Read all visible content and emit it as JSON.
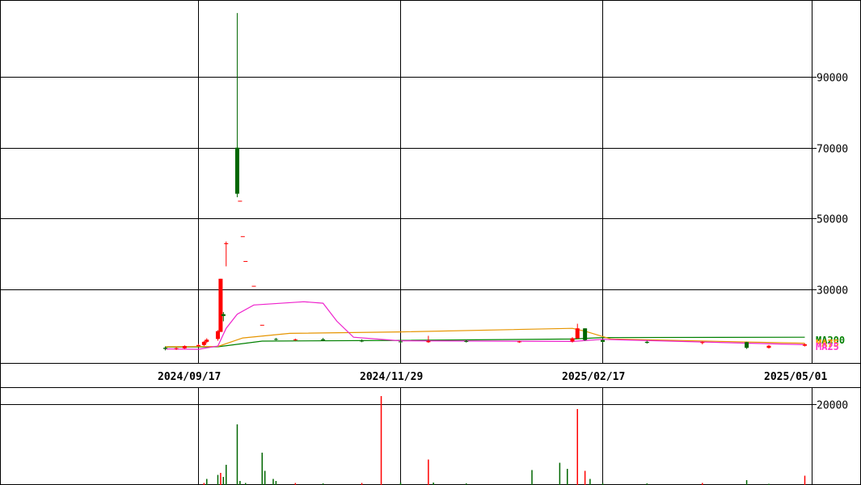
{
  "chart_data": [
    {
      "type": "candlestick",
      "title": "",
      "y_ticks": [
        "30000",
        "50000",
        "70000",
        "90000"
      ],
      "ylim": [
        10000,
        110000
      ],
      "x_ticks": [
        "2024/09/17",
        "2024/11/29",
        "2025/02/17",
        "2025/05/01"
      ],
      "grid": true,
      "legend": [
        {
          "name": "MA200",
          "color": "#008000"
        },
        {
          "name": "MA75",
          "color": "#ff9900"
        },
        {
          "name": "MA25",
          "color": "#ff33cc"
        }
      ],
      "colors": {
        "up": "#ff0000",
        "down": "#006600",
        "ma200": "#008000",
        "ma75": "#e69500",
        "ma25": "#ee22cc"
      },
      "candles": [
        {
          "date": "2024/09/05",
          "open": 13500,
          "high": 13900,
          "low": 12800,
          "close": 13200
        },
        {
          "date": "2024/09/09",
          "open": 13200,
          "high": 13700,
          "low": 12900,
          "close": 13400
        },
        {
          "date": "2024/09/12",
          "open": 13400,
          "high": 14200,
          "low": 13200,
          "close": 14000
        },
        {
          "date": "2024/09/17",
          "open": 14000,
          "high": 14600,
          "low": 13800,
          "close": 14300
        },
        {
          "date": "2024/09/19",
          "open": 14300,
          "high": 15500,
          "low": 14000,
          "close": 15200
        },
        {
          "date": "2024/09/20",
          "open": 15200,
          "high": 16200,
          "low": 14800,
          "close": 15800
        },
        {
          "date": "2024/09/24",
          "open": 16000,
          "high": 18500,
          "low": 15500,
          "close": 18200
        },
        {
          "date": "2024/09/25",
          "open": 18000,
          "high": 33000,
          "low": 18000,
          "close": 33000
        },
        {
          "date": "2024/09/26",
          "open": 23000,
          "high": 23600,
          "low": 21000,
          "close": 22500
        },
        {
          "date": "2024/09/27",
          "open": 43000,
          "high": 43500,
          "low": 36500,
          "close": 43000
        },
        {
          "date": "2024/10/01",
          "open": 70000,
          "high": 108000,
          "low": 56000,
          "close": 57000
        },
        {
          "date": "2024/10/02",
          "open": 55000,
          "high": 55000,
          "low": 55000,
          "close": 55000
        },
        {
          "date": "2024/10/03",
          "open": 45000,
          "high": 45000,
          "low": 45000,
          "close": 45000
        },
        {
          "date": "2024/10/04",
          "open": 38000,
          "high": 38000,
          "low": 38000,
          "close": 38000
        },
        {
          "date": "2024/10/07",
          "open": 31000,
          "high": 31000,
          "low": 31000,
          "close": 31000
        },
        {
          "date": "2024/10/10",
          "open": 20000,
          "high": 20000,
          "low": 20000,
          "close": 20000
        },
        {
          "date": "2024/10/15",
          "open": 16000,
          "high": 16300,
          "low": 15600,
          "close": 15800
        },
        {
          "date": "2024/10/22",
          "open": 15800,
          "high": 16100,
          "low": 15500,
          "close": 15900
        },
        {
          "date": "2024/11/01",
          "open": 15900,
          "high": 16300,
          "low": 15400,
          "close": 15600
        },
        {
          "date": "2024/11/15",
          "open": 15600,
          "high": 15900,
          "low": 15100,
          "close": 15300
        },
        {
          "date": "2024/11/29",
          "open": 15300,
          "high": 15600,
          "low": 14800,
          "close": 15100
        },
        {
          "date": "2024/12/10",
          "open": 15100,
          "high": 16900,
          "low": 14900,
          "close": 15400
        },
        {
          "date": "2024/12/25",
          "open": 15400,
          "high": 15700,
          "low": 15000,
          "close": 15200
        },
        {
          "date": "2025/01/15",
          "open": 15200,
          "high": 15500,
          "low": 14900,
          "close": 15300
        },
        {
          "date": "2025/02/05",
          "open": 15300,
          "high": 16500,
          "low": 15000,
          "close": 16200
        },
        {
          "date": "2025/02/07",
          "open": 16200,
          "high": 20300,
          "low": 16000,
          "close": 19000
        },
        {
          "date": "2025/02/10",
          "open": 19000,
          "high": 19000,
          "low": 15500,
          "close": 15700
        },
        {
          "date": "2025/02/17",
          "open": 15700,
          "high": 15900,
          "low": 15000,
          "close": 15200
        },
        {
          "date": "2025/03/05",
          "open": 15200,
          "high": 15500,
          "low": 14700,
          "close": 14900
        },
        {
          "date": "2025/03/25",
          "open": 14900,
          "high": 15300,
          "low": 14500,
          "close": 15100
        },
        {
          "date": "2025/04/10",
          "open": 15100,
          "high": 15200,
          "low": 13200,
          "close": 13500
        },
        {
          "date": "2025/04/18",
          "open": 13500,
          "high": 14300,
          "low": 13300,
          "close": 14100
        },
        {
          "date": "2025/05/01",
          "open": 14100,
          "high": 14700,
          "low": 13900,
          "close": 14500
        }
      ],
      "ma25": [
        {
          "date": "2024/09/05",
          "value": 13200
        },
        {
          "date": "2024/09/17",
          "value": 13100
        },
        {
          "date": "2024/09/24",
          "value": 14000
        },
        {
          "date": "2024/09/27",
          "value": 19000
        },
        {
          "date": "2024/10/01",
          "value": 23000
        },
        {
          "date": "2024/10/07",
          "value": 25600
        },
        {
          "date": "2024/10/25",
          "value": 26500
        },
        {
          "date": "2024/11/01",
          "value": 26100
        },
        {
          "date": "2024/11/06",
          "value": 21000
        },
        {
          "date": "2024/11/12",
          "value": 16500
        },
        {
          "date": "2024/11/29",
          "value": 15500
        },
        {
          "date": "2025/02/05",
          "value": 15300
        },
        {
          "date": "2025/02/17",
          "value": 15900
        },
        {
          "date": "2025/05/01",
          "value": 14400
        }
      ],
      "ma75": [
        {
          "date": "2024/09/05",
          "value": 13800
        },
        {
          "date": "2024/09/24",
          "value": 13900
        },
        {
          "date": "2024/10/03",
          "value": 16300
        },
        {
          "date": "2024/10/20",
          "value": 17600
        },
        {
          "date": "2024/11/29",
          "value": 18000
        },
        {
          "date": "2025/02/05",
          "value": 19000
        },
        {
          "date": "2025/02/10",
          "value": 18200
        },
        {
          "date": "2025/02/20",
          "value": 16000
        },
        {
          "date": "2025/05/01",
          "value": 14800
        }
      ],
      "ma200": [
        {
          "date": "2024/09/05",
          "value": 13700
        },
        {
          "date": "2024/09/24",
          "value": 13800
        },
        {
          "date": "2024/10/10",
          "value": 15400
        },
        {
          "date": "2024/11/29",
          "value": 15600
        },
        {
          "date": "2025/02/05",
          "value": 16000
        },
        {
          "date": "2025/02/17",
          "value": 16400
        },
        {
          "date": "2025/05/01",
          "value": 16500
        }
      ]
    },
    {
      "type": "bar",
      "title": "",
      "y_ticks": [
        "20000"
      ],
      "ylim": [
        0,
        25000
      ],
      "volumes": [
        {
          "date": "2024/09/19",
          "value": 500,
          "up": true
        },
        {
          "date": "2024/09/20",
          "value": 1500,
          "up": false
        },
        {
          "date": "2024/09/24",
          "value": 2500,
          "up": false
        },
        {
          "date": "2024/09/25",
          "value": 3000,
          "up": true
        },
        {
          "date": "2024/09/26",
          "value": 2000,
          "up": false
        },
        {
          "date": "2024/09/27",
          "value": 5000,
          "up": false
        },
        {
          "date": "2024/10/01",
          "value": 15000,
          "up": false
        },
        {
          "date": "2024/10/02",
          "value": 1000,
          "up": false
        },
        {
          "date": "2024/10/04",
          "value": 500,
          "up": false
        },
        {
          "date": "2024/10/10",
          "value": 8000,
          "up": false
        },
        {
          "date": "2024/10/11",
          "value": 3500,
          "up": false
        },
        {
          "date": "2024/10/14",
          "value": 1500,
          "up": false
        },
        {
          "date": "2024/10/15",
          "value": 1000,
          "up": false
        },
        {
          "date": "2024/10/22",
          "value": 500,
          "up": true
        },
        {
          "date": "2024/11/01",
          "value": 400,
          "up": false
        },
        {
          "date": "2024/11/15",
          "value": 500,
          "up": true
        },
        {
          "date": "2024/11/22",
          "value": 22000,
          "up": true
        },
        {
          "date": "2024/11/29",
          "value": 600,
          "up": false
        },
        {
          "date": "2024/12/10",
          "value": 6300,
          "up": true
        },
        {
          "date": "2024/12/12",
          "value": 600,
          "up": false
        },
        {
          "date": "2024/12/25",
          "value": 400,
          "up": false
        },
        {
          "date": "2025/01/20",
          "value": 3700,
          "up": false
        },
        {
          "date": "2025/01/31",
          "value": 5500,
          "up": false
        },
        {
          "date": "2025/02/03",
          "value": 4000,
          "up": false
        },
        {
          "date": "2025/02/07",
          "value": 18800,
          "up": true
        },
        {
          "date": "2025/02/10",
          "value": 3500,
          "up": true
        },
        {
          "date": "2025/02/12",
          "value": 1500,
          "up": false
        },
        {
          "date": "2025/02/17",
          "value": 500,
          "up": false
        },
        {
          "date": "2025/03/05",
          "value": 400,
          "up": false
        },
        {
          "date": "2025/03/25",
          "value": 500,
          "up": true
        },
        {
          "date": "2025/04/10",
          "value": 1200,
          "up": false
        },
        {
          "date": "2025/04/18",
          "value": 300,
          "up": false
        },
        {
          "date": "2025/05/01",
          "value": 2300,
          "up": true
        }
      ]
    }
  ]
}
